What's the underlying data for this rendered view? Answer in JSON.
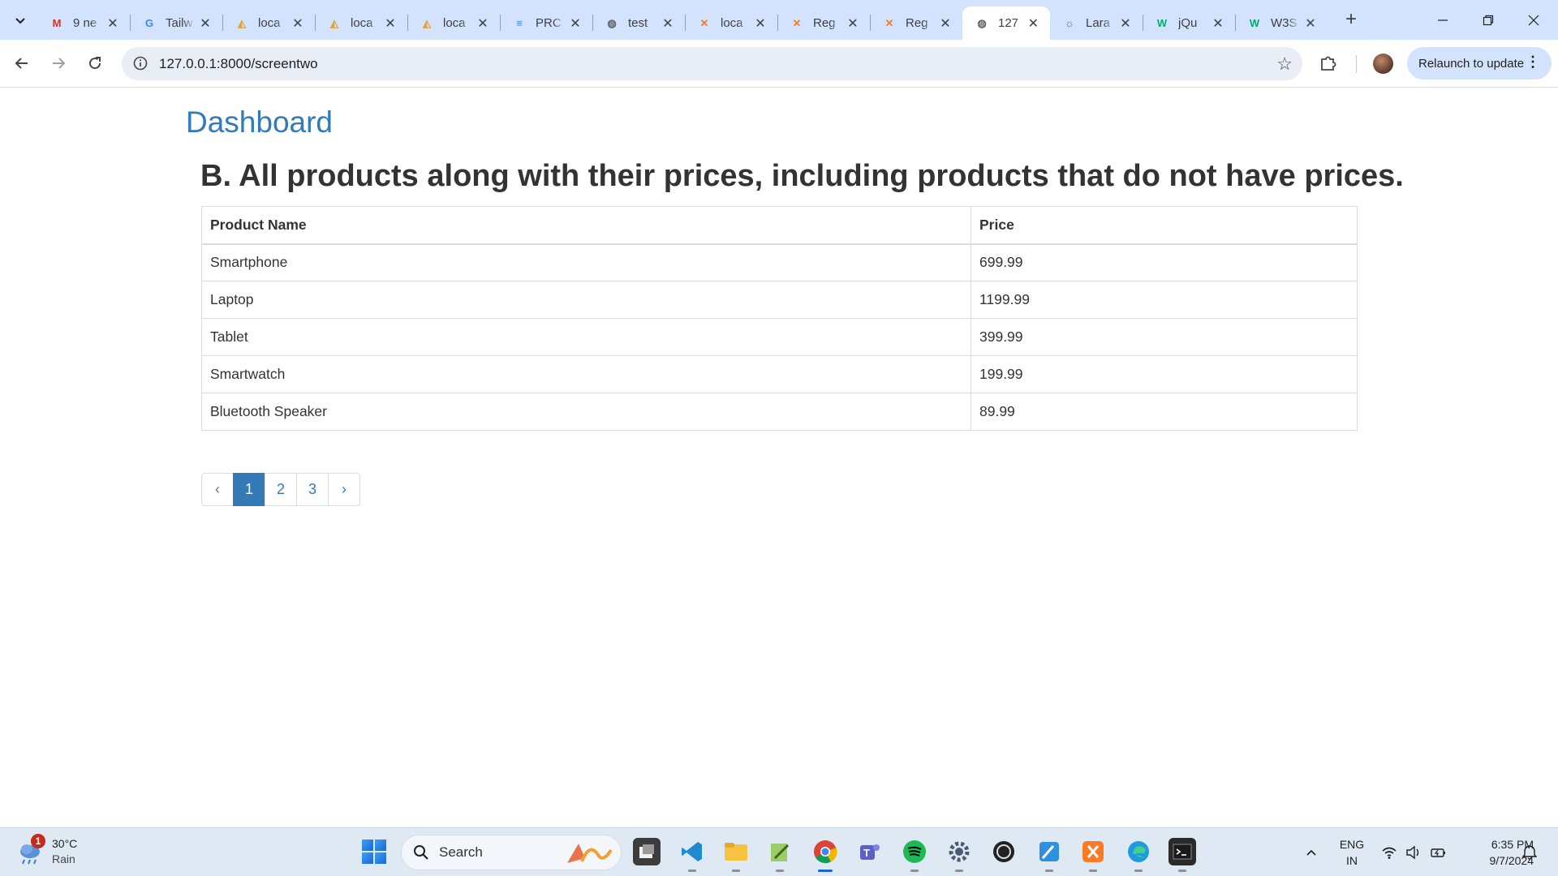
{
  "browser": {
    "tabs": [
      {
        "title": "9 ne",
        "icon": "gmail-icon",
        "active": false
      },
      {
        "title": "Tailw",
        "icon": "google-icon",
        "active": false
      },
      {
        "title": "loca",
        "icon": "phpmyadmin-icon",
        "active": false
      },
      {
        "title": "loca",
        "icon": "phpmyadmin-icon",
        "active": false
      },
      {
        "title": "loca",
        "icon": "phpmyadmin-icon",
        "active": false
      },
      {
        "title": "PRC",
        "icon": "docs-icon",
        "active": false
      },
      {
        "title": "test",
        "icon": "globe-icon",
        "active": false
      },
      {
        "title": "loca",
        "icon": "xampp-icon",
        "active": false
      },
      {
        "title": "Reg",
        "icon": "xampp-icon",
        "active": false
      },
      {
        "title": "Reg",
        "icon": "xampp-icon",
        "active": false
      },
      {
        "title": "127",
        "icon": "globe-icon",
        "active": true
      },
      {
        "title": "Lara",
        "icon": "sun-icon",
        "active": false
      },
      {
        "title": "jQu",
        "icon": "w3schools-icon",
        "active": false
      },
      {
        "title": "W3S",
        "icon": "w3schools-icon",
        "active": false
      }
    ],
    "url": "127.0.0.1:8000/screentwo",
    "relaunch_label": "Relaunch to update"
  },
  "page": {
    "heading": "Dashboard",
    "question": "B. All products along with their prices, including products that do not have prices.",
    "table": {
      "headers": [
        "Product Name",
        "Price"
      ],
      "rows": [
        [
          "Smartphone",
          "699.99"
        ],
        [
          "Laptop",
          "1199.99"
        ],
        [
          "Tablet",
          "399.99"
        ],
        [
          "Smartwatch",
          "199.99"
        ],
        [
          "Bluetooth Speaker",
          "89.99"
        ]
      ]
    },
    "pagination": {
      "prev": "‹",
      "pages": [
        "1",
        "2",
        "3"
      ],
      "current": "1",
      "next": "›"
    }
  },
  "taskbar": {
    "weather": {
      "temp": "30°C",
      "condition": "Rain",
      "badge": "1"
    },
    "search_label": "Search",
    "language": {
      "line1": "ENG",
      "line2": "IN"
    },
    "time": "6:35 PM",
    "date": "9/7/2024"
  },
  "colors": {
    "link": "#337ab7",
    "tabstrip": "#d3e3fd",
    "taskbar": "#dfe9f4"
  }
}
